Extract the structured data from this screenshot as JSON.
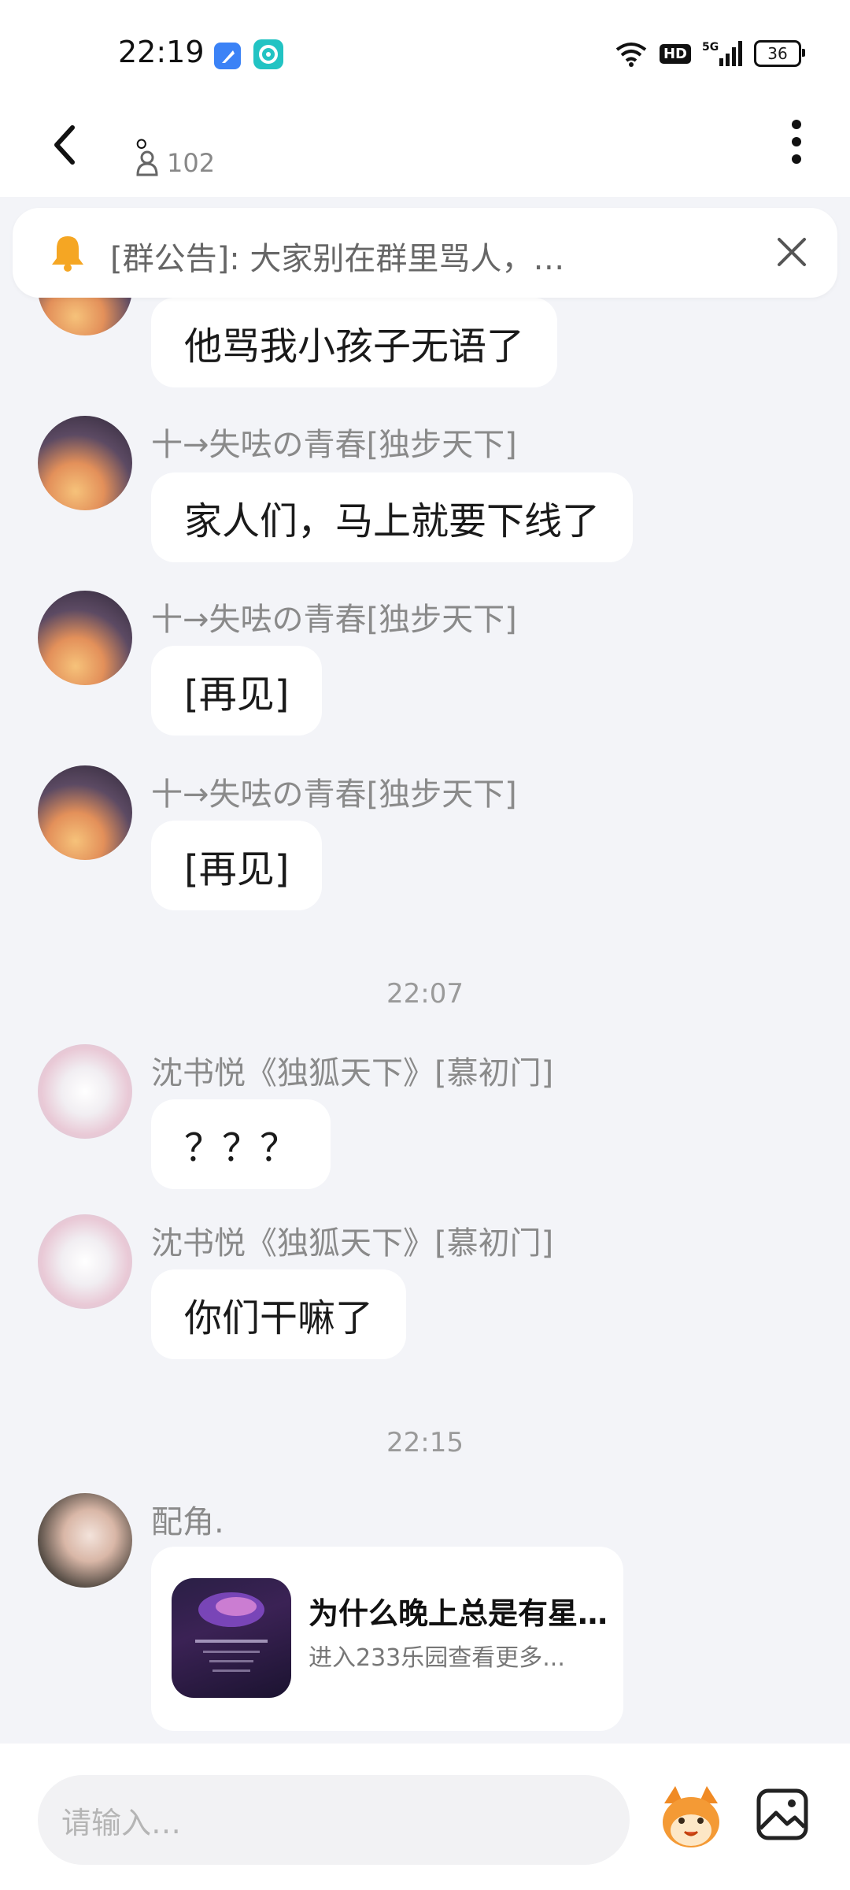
{
  "status_bar": {
    "time": "22:19",
    "network": "5G",
    "hd": "HD",
    "battery": "36"
  },
  "header": {
    "title": "。",
    "member_count": "102"
  },
  "notice": {
    "text": "[群公告]: 大家别在群里骂人，…"
  },
  "messages": [
    {
      "sender": "",
      "text": "他骂我小孩子无语了"
    },
    {
      "sender": "十→失呿の青春[独步天下]",
      "text": "家人们，马上就要下线了"
    },
    {
      "sender": "十→失呿の青春[独步天下]",
      "text": "[再见]"
    },
    {
      "sender": "十→失呿の青春[独步天下]",
      "text": "[再见]"
    },
    {
      "sender": "沈书悦《独狐天下》[慕初门]",
      "text": "？？？"
    },
    {
      "sender": "沈书悦《独狐天下》[慕初门]",
      "text": "你们干嘛了"
    }
  ],
  "timestamps": [
    "22:07",
    "22:15"
  ],
  "last_message": {
    "sender": "配角.",
    "card_title": "为什么晚上总是有星…",
    "card_subtitle": "进入233乐园查看更多..."
  },
  "input": {
    "placeholder": "请输入…"
  },
  "colors": {
    "background": "#f3f4f8",
    "bubble": "#ffffff",
    "bell": "#f5a623"
  }
}
